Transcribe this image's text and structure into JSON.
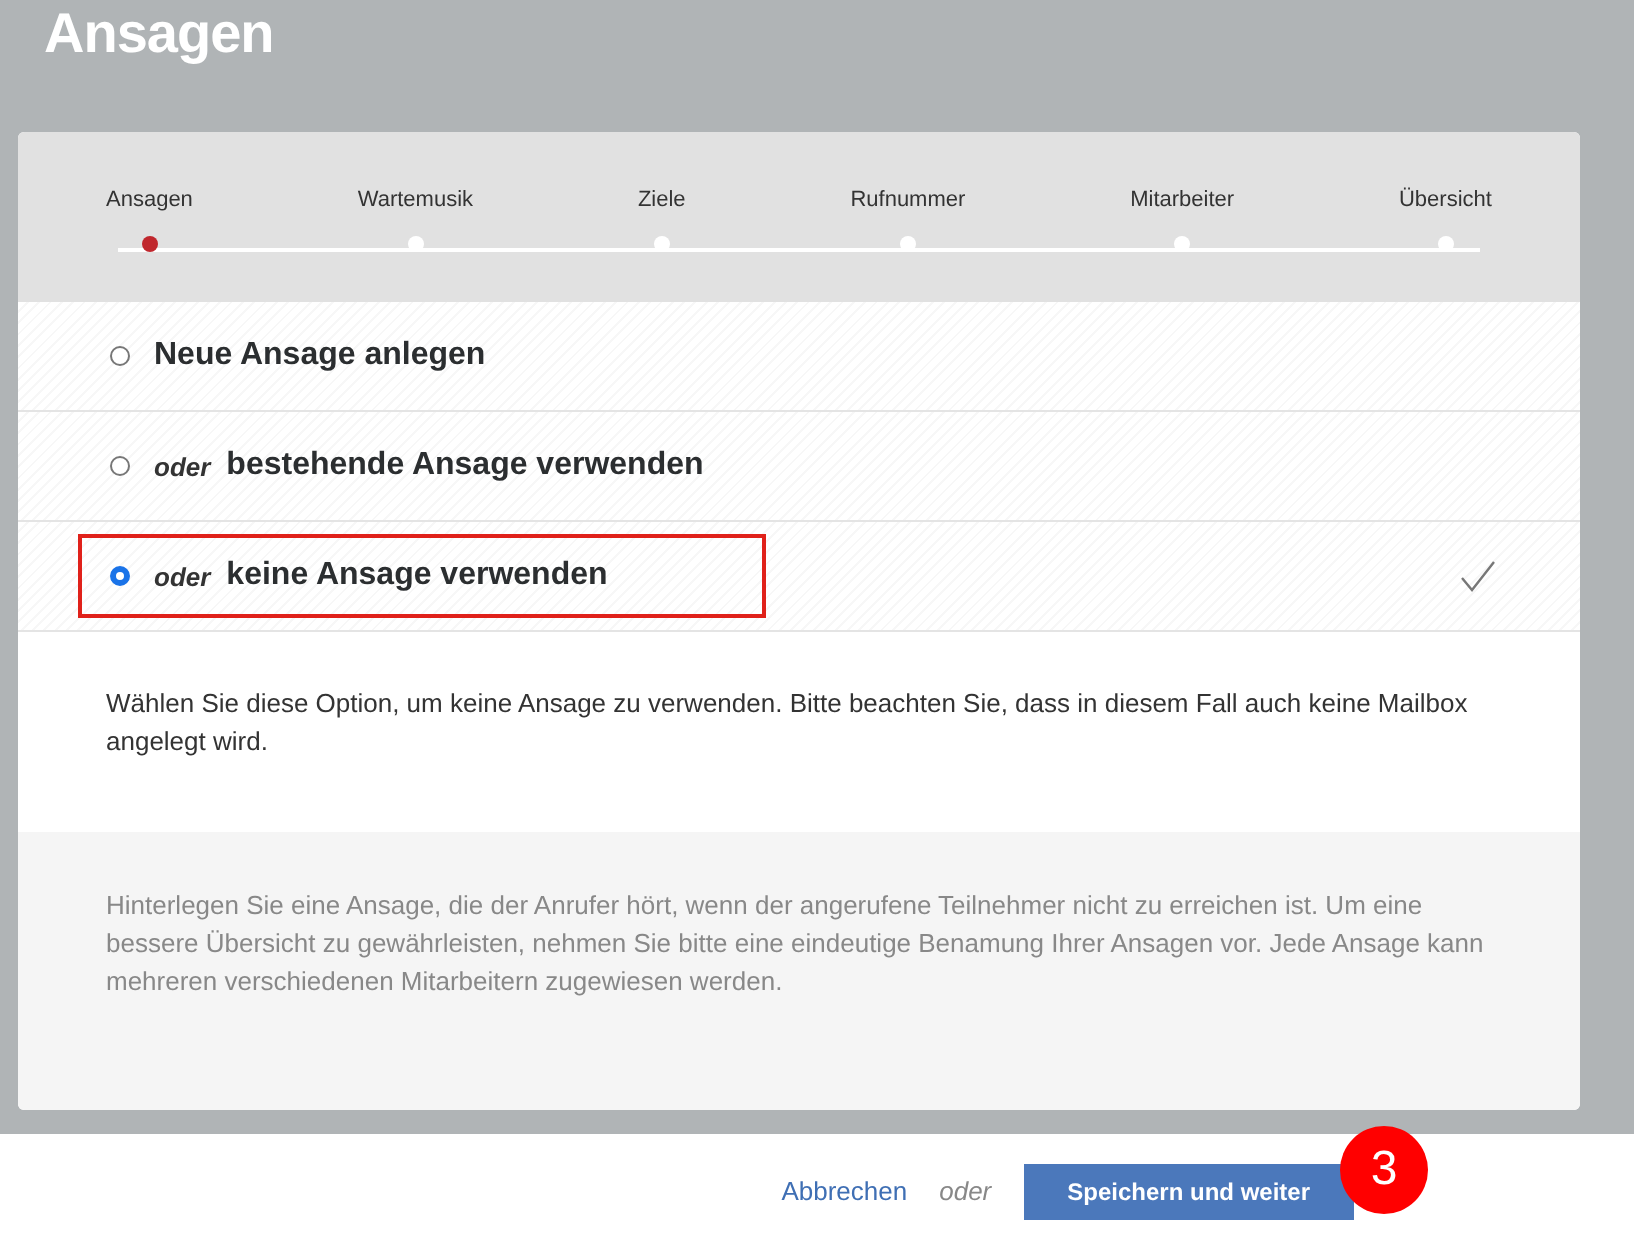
{
  "page_title": "Ansagen",
  "steps": [
    {
      "label": "Ansagen",
      "selected": true
    },
    {
      "label": "Wartemusik",
      "selected": false
    },
    {
      "label": "Ziele",
      "selected": false
    },
    {
      "label": "Rufnummer",
      "selected": false
    },
    {
      "label": "Mitarbeiter",
      "selected": false
    },
    {
      "label": "Übersicht",
      "selected": false
    }
  ],
  "options": [
    {
      "label": "Neue Ansage anlegen",
      "selected": false,
      "highlighted": false
    },
    {
      "prefix": "oder",
      "label": "bestehende Ansage verwenden",
      "selected": false,
      "highlighted": false
    },
    {
      "prefix": "oder",
      "label": "keine Ansage verwenden",
      "selected": true,
      "highlighted": true
    }
  ],
  "description": "Wählen Sie diese Option, um keine Ansage zu verwenden. Bitte beachten Sie, dass in diesem Fall auch keine Mailbox angelegt wird.",
  "info": "Hinterlegen Sie eine Ansage, die der Anrufer hört, wenn der angerufene Teilnehmer nicht zu erreichen ist. Um eine bessere Übersicht zu gewährleisten, nehmen Sie bitte eine eindeutige Benamung Ihrer Ansagen vor. Jede Ansage kann mehreren verschiedenen Mitarbeitern zugewiesen werden.",
  "footer": {
    "cancel": "Abbrechen",
    "separator": "oder",
    "submit": "Speichern und weiter",
    "badge": "3"
  }
}
